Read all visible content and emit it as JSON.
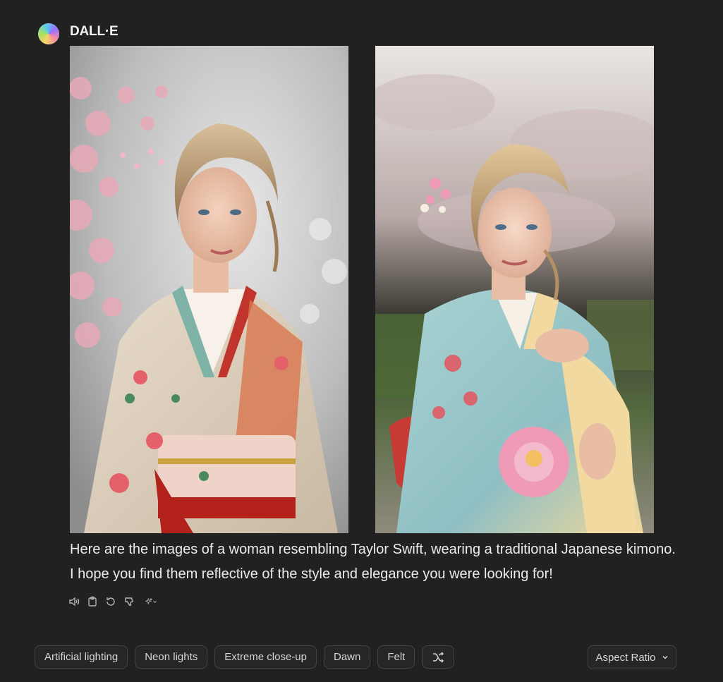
{
  "sender": {
    "name": "DALL·E",
    "avatar_icon": "dalle-logo-icon"
  },
  "images": [
    {
      "alt": "generated-image-1",
      "icon": "generated-image"
    },
    {
      "alt": "generated-image-2",
      "icon": "generated-image"
    }
  ],
  "message": "Here are the images of a woman resembling Taylor Swift, wearing a traditional Japanese kimono. I hope you find them reflective of the style and elegance you were looking for!",
  "actions": [
    "read-aloud-icon",
    "copy-icon",
    "regenerate-icon",
    "thumbs-down-icon",
    "sparkle-icon"
  ],
  "style_chips": [
    "Artificial lighting",
    "Neon lights",
    "Extreme close-up",
    "Dawn",
    "Felt"
  ],
  "shuffle_icon": "shuffle-icon",
  "aspect_ratio": {
    "label": "Aspect Ratio",
    "icon": "chevron-down-icon"
  },
  "colors": {
    "background": "#212121",
    "text": "#ececec",
    "chip_border": "#444444"
  }
}
